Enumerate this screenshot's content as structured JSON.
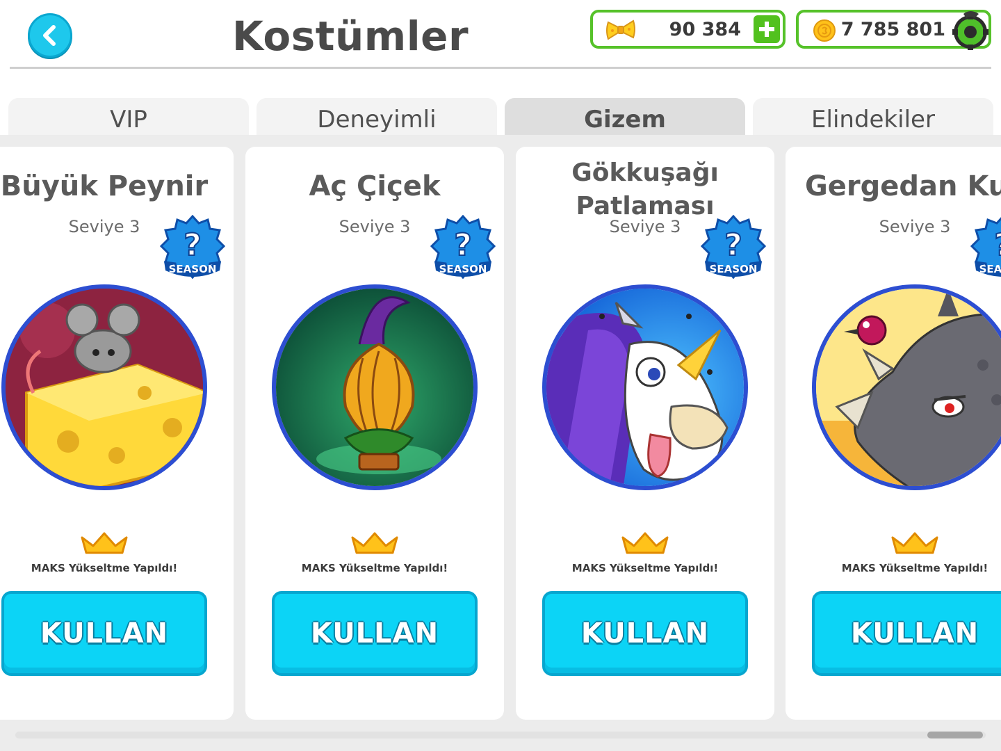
{
  "header": {
    "title": "Kostümler",
    "back_icon": "chevron-left-icon",
    "bows_amount": "90 384",
    "coins_amount": "7 785 801"
  },
  "tabs": [
    {
      "label": "VIP",
      "active": false
    },
    {
      "label": "Deneyimli",
      "active": false
    },
    {
      "label": "Gizem",
      "active": true
    },
    {
      "label": "Elindekiler",
      "active": false
    }
  ],
  "cards": [
    {
      "title": "Büyük Peynir",
      "level": "Seviye 3",
      "badge": "SEASON",
      "badge_mark": "?",
      "status": "MAKS Yükseltme Yapıldı!",
      "button": "KULLAN"
    },
    {
      "title": "Aç Çiçek",
      "level": "Seviye 3",
      "badge": "SEASON",
      "badge_mark": "?",
      "status": "MAKS Yükseltme Yapıldı!",
      "button": "KULLAN"
    },
    {
      "title_line1": "Gökkuşağı",
      "title_line2": "Patlaması",
      "level": "Seviye 3",
      "badge": "SEASON",
      "badge_mark": "?",
      "status": "MAKS Yükseltme Yapıldı!",
      "button": "KULLAN"
    },
    {
      "title": "Gergedan Kuş",
      "level": "Seviye 3",
      "badge": "SEASON",
      "badge_mark": "?",
      "status": "MAKS Yükseltme Yapıldı!",
      "button": "KULLAN"
    }
  ],
  "colors": {
    "accent_cyan": "#0cd4f6",
    "currency_border": "#56c22a",
    "art_border": "#2d4ed1",
    "crown": "#ffc21a"
  }
}
